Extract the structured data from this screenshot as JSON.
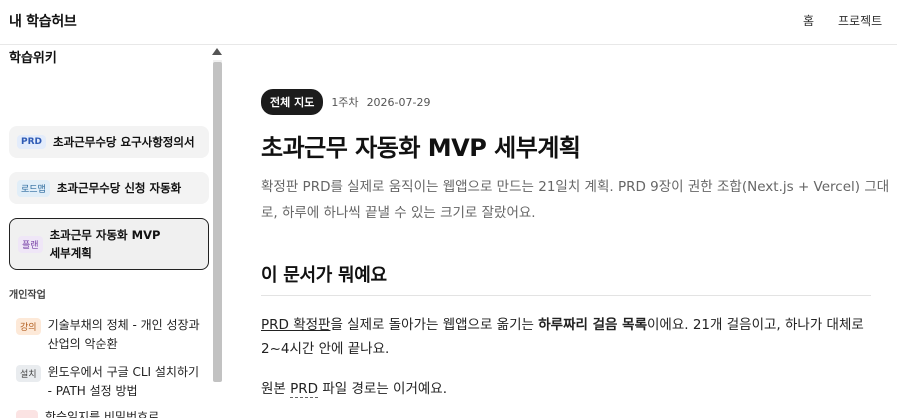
{
  "header": {
    "brand": "내 학습허브",
    "nav": {
      "home": "홈",
      "projects": "프로젝트"
    }
  },
  "sidebar": {
    "title": "학습위키",
    "cards": [
      {
        "badge": "PRD",
        "label": "초과근무수당 요구사항정의서"
      },
      {
        "badge": "로드맵",
        "label": "초과근무수당 신청 자동화"
      },
      {
        "badge": "플랜",
        "label_line1": "초과근무 자동화 MVP",
        "label_line2": "세부계획"
      }
    ],
    "group_label": "개인작업",
    "items": [
      {
        "badge": "강의",
        "line1": "기술부채의 정체 - 개인 성장과",
        "line2": "산업의 악순환"
      },
      {
        "badge": "설치",
        "line1": "윈도우에서 구글 CLI 설치하기",
        "line2": "- PATH 설정 방법"
      },
      {
        "badge": "",
        "line1": "학습일지를 비밀번호로"
      }
    ]
  },
  "main": {
    "pill": "전체 지도",
    "week": "1주차",
    "date": "2026-07-29",
    "title": "초과근무 자동화 MVP 세부계획",
    "lead": "확정판 PRD를 실제로 움직이는 웹앱으로 만드는 21일치 계획. PRD 9장이 권한 조합(Next.js + Vercel) 그대로, 하루에 하나씩 끝낼 수 있는 크기로 잘랐어요.",
    "section_title": "이 문서가 뭐예요",
    "p1_link": "PRD 확정판",
    "p1_a": "을 실제로 돌아가는 웹앱으로 옮기는 ",
    "p1_bold": "하루짜리 걸음 목록",
    "p1_b": "이에요. 21개 걸음이고, 하나가 대체로 2~4시간 안에 끝나요.",
    "p2_a": "원본 ",
    "p2_term": "PRD",
    "p2_b": " 파일 경로는 이거예요."
  }
}
